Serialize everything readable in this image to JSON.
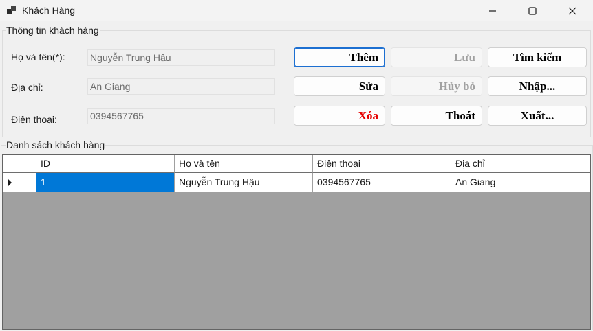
{
  "window": {
    "title": "Khách Hàng",
    "icons": {
      "app": "app-icon",
      "minimize": "minimize-icon",
      "maximize": "maximize-icon",
      "close": "close-icon"
    }
  },
  "info_group": {
    "label": "Thông tin khách hàng",
    "fields": [
      {
        "label": "Họ và tên(*):",
        "value": "Nguyễn Trung Hậu"
      },
      {
        "label": "Địa chỉ:",
        "value": "An Giang"
      },
      {
        "label": "Điện thoại:",
        "value": "0394567765"
      }
    ],
    "buttons": {
      "them": "Thêm",
      "luu": "Lưu",
      "tim_kiem": "Tìm kiếm",
      "sua": "Sửa",
      "huy_bo": "Hủy bỏ",
      "nhap": "Nhập...",
      "xoa": "Xóa",
      "thoat": "Thoát",
      "xuat": "Xuất..."
    }
  },
  "list_group": {
    "label": "Danh sách khách hàng",
    "columns": [
      "ID",
      "Họ và tên",
      "Điện thoại",
      "Địa chỉ"
    ],
    "rows": [
      {
        "id": "1",
        "name": "Nguyễn Trung Hậu",
        "phone": "0394567765",
        "address": "An Giang"
      }
    ]
  },
  "colors": {
    "selection": "#0078d7",
    "delete_text": "#e60000",
    "grid_background": "#a0a0a0"
  }
}
